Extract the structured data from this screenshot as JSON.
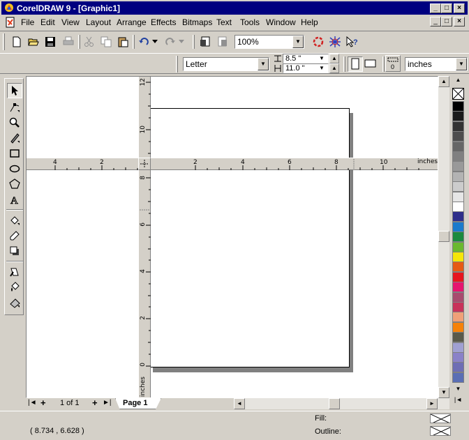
{
  "window": {
    "title": "CorelDRAW 9 - [Graphic1]",
    "controls": {
      "minimize": "_",
      "maximize": "□",
      "close": "×"
    }
  },
  "menubar": {
    "items": [
      "File",
      "Edit",
      "View",
      "Layout",
      "Arrange",
      "Effects",
      "Bitmaps",
      "Text",
      "Tools",
      "Window",
      "Help"
    ],
    "mnemonics": [
      "F",
      "E",
      "V",
      "L",
      "A",
      "c",
      "B",
      "T",
      "o",
      "W",
      "H"
    ]
  },
  "standard_toolbar": {
    "buttons": [
      "new-document-icon",
      "open-icon",
      "save-icon",
      "print-icon",
      "cut-icon",
      "copy-icon",
      "paste-icon",
      "undo-icon",
      "redo-icon",
      "import-icon",
      "export-icon",
      "application-launcher-icon",
      "corel-online-icon",
      "whats-this-help-icon"
    ],
    "zoom_level": "100%"
  },
  "property_bar": {
    "paper_type": "Letter",
    "paper_width": "8.5 \"",
    "paper_height": "11.0 \"",
    "orientation": "portrait",
    "units": "inches"
  },
  "toolbox": {
    "tools": [
      "pick-tool-icon",
      "shape-tool-icon",
      "zoom-tool-icon",
      "freehand-tool-icon",
      "rectangle-tool-icon",
      "ellipse-tool-icon",
      "polygon-tool-icon",
      "text-tool-icon",
      "interactive-fill-icon",
      "eyedropper-icon",
      "interactive-shadow-icon",
      "outline-tool-icon",
      "fill-tool-icon",
      "interactive-fill-tool-icon"
    ],
    "active_tool": "pick-tool-icon"
  },
  "rulers": {
    "horizontal_labels": [
      "4",
      "2",
      "2",
      "4",
      "6",
      "8",
      "10"
    ],
    "horizontal_unit": "inches",
    "vertical_labels": [
      "12",
      "10",
      "8",
      "6",
      "4",
      "2",
      "0"
    ],
    "vertical_unit": "inches"
  },
  "page_navigator": {
    "first": "|◄",
    "add_before": "+",
    "page_count": "1 of 1",
    "add_after": "+",
    "last": "►|",
    "active_tab": "Page 1"
  },
  "status": {
    "cursor_coordinates": "( 8.734 , 6.628 )",
    "fill_label": "Fill:",
    "outline_label": "Outline:"
  },
  "palette": {
    "no_color": "none",
    "colors": [
      "#000000",
      "#1a1a1a",
      "#333333",
      "#4d4d4d",
      "#666666",
      "#808080",
      "#999999",
      "#b3b3b3",
      "#cccccc",
      "#e6e6e6",
      "#ffffff",
      "#2e2e8a",
      "#1a7acc",
      "#1a8a3e",
      "#6ab82e",
      "#f5e60a",
      "#e65a14",
      "#e6141e",
      "#e6146e",
      "#a84a6e",
      "#c8325a",
      "#f0a078",
      "#f5820a",
      "#5a5a4a",
      "#a0a0d2",
      "#8a82c8",
      "#6e6eb4",
      "#5a6eb4"
    ]
  }
}
